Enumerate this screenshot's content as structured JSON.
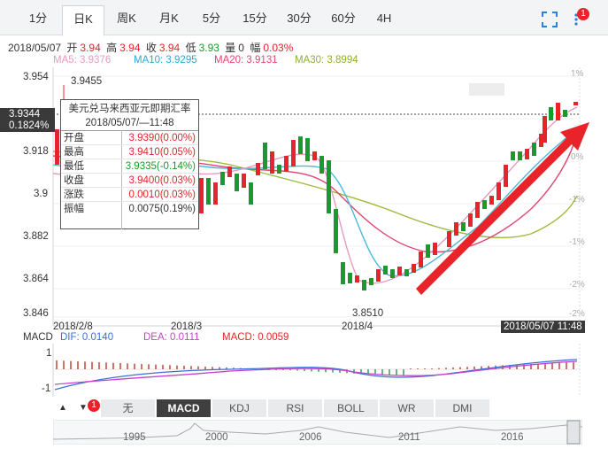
{
  "tabs": [
    {
      "label": "1分"
    },
    {
      "label": "日K"
    },
    {
      "label": "周K"
    },
    {
      "label": "月K"
    },
    {
      "label": "5分"
    },
    {
      "label": "15分"
    },
    {
      "label": "30分"
    },
    {
      "label": "60分"
    },
    {
      "label": "4H"
    }
  ],
  "active_tab": "日K",
  "toolbar": {
    "fullscreen_icon": "expand-icon",
    "more_icon": "dots-icon",
    "badge": "1"
  },
  "info": {
    "date": "2018/05/07",
    "open_k": "开",
    "open_v": "3.94",
    "high_k": "高",
    "high_v": "3.94",
    "close_k": "收",
    "close_v": "3.94",
    "low_k": "低",
    "low_v": "3.93",
    "vol_k": "量",
    "vol_v": "0",
    "amp_k": "幅",
    "amp_v": "0.03%"
  },
  "ma": {
    "ma5": "MA5: 3.9376",
    "ma10": "MA10: 3.9295",
    "ma20": "MA20: 3.9131",
    "ma30": "MA30: 3.8994",
    "c5": "#e89bbd",
    "c10": "#4bb8d9",
    "c20": "#e0456f",
    "c30": "#9dbb3c"
  },
  "axis_left": [
    "3.954",
    "3.936",
    "3.918",
    "3.9",
    "3.882",
    "3.864",
    "3.846"
  ],
  "axis_right": [
    "1%",
    "0%",
    "-1%",
    "-1%",
    "-2%",
    "-2%"
  ],
  "price_tag": {
    "price": "3.9344",
    "pct": "0.1824%"
  },
  "high_label": "3.9455",
  "low_label": "3.8510",
  "x_labels": [
    "2018/2/8",
    "2018/3",
    "2018/4"
  ],
  "x_cursor": "2018/05/07 11:48",
  "tooltip": {
    "title": "美元兑马来西亚元即期汇率",
    "time": "2018/05/07/—11:48",
    "rows": [
      {
        "k": "开盘",
        "v": "3.9390(0.00%)",
        "c": "#e8232a"
      },
      {
        "k": "最高",
        "v": "3.9410(0.05%)",
        "c": "#e8232a"
      },
      {
        "k": "最低",
        "v": "3.9335(-0.14%)",
        "c": "#1a9a2a"
      },
      {
        "k": "收盘",
        "v": "3.9400(0.03%)",
        "c": "#e8232a"
      },
      {
        "k": "涨跌",
        "v": "0.0010(0.03%)",
        "c": "#e8232a"
      },
      {
        "k": "振幅",
        "v": "0.0075(0.19%)",
        "c": "#333"
      }
    ]
  },
  "macd": {
    "title": "MACD",
    "dif": "DIF: 0.0140",
    "dea": "DEA: 0.0111",
    "macd": "MACD: 0.0059",
    "axis": [
      "1",
      "-1"
    ]
  },
  "indicators": [
    {
      "label": "无"
    },
    {
      "label": "MACD"
    },
    {
      "label": "KDJ"
    },
    {
      "label": "RSI"
    },
    {
      "label": "BOLL"
    },
    {
      "label": "WR"
    },
    {
      "label": "DMI"
    }
  ],
  "active_indicator": "MACD",
  "nav_arrows": {
    "up": "▲",
    "down": "▼",
    "badge": "1"
  },
  "timeline": [
    "1995",
    "2000",
    "2006",
    "2011",
    "2016"
  ]
}
